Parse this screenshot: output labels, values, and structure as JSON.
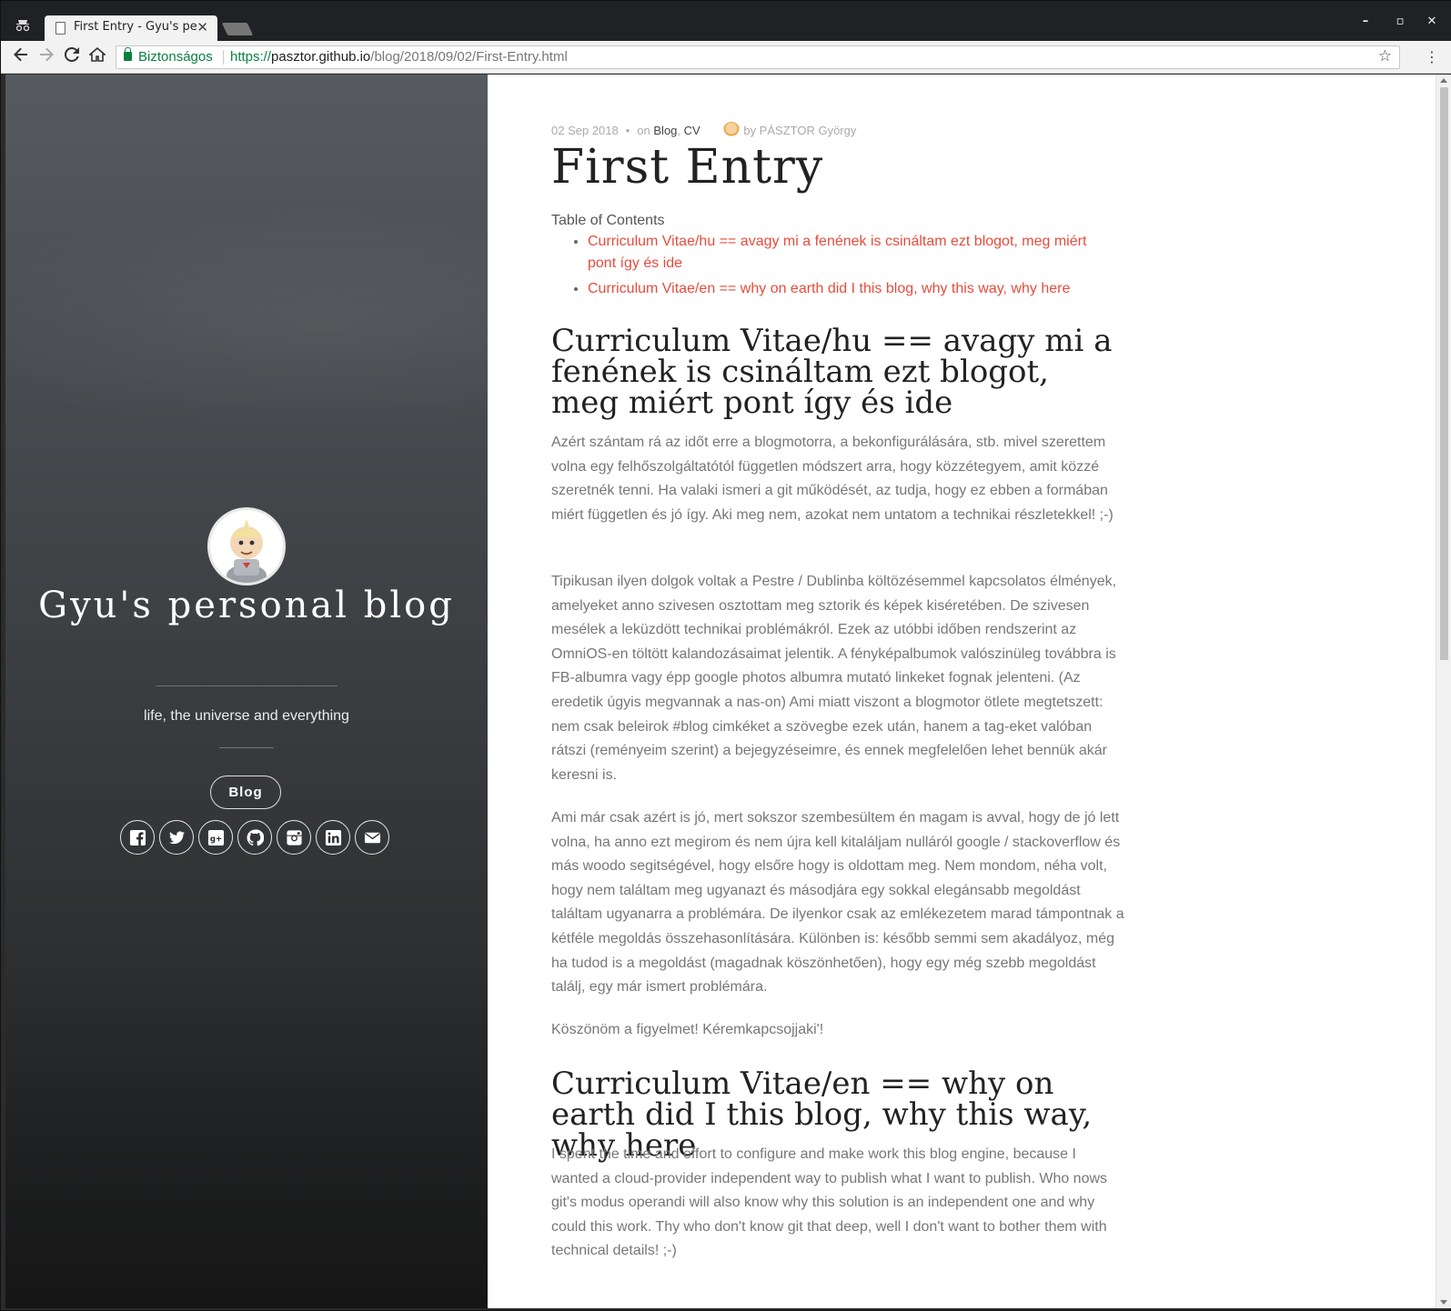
{
  "browser": {
    "tab_title": "First Entry - Gyu's personal blog",
    "security_label": "Biztonságos",
    "url_scheme": "https://",
    "url_host": "pasztor.github.io",
    "url_path": "/blog/2018/09/02/First-Entry.html"
  },
  "sidebar": {
    "title": "Gyu's personal blog",
    "tagline": "life, the universe and everything",
    "nav_button": "Blog",
    "social": [
      "facebook-icon",
      "twitter-icon",
      "google-plus-icon",
      "github-icon",
      "instagram-icon",
      "linkedin-icon",
      "email-icon"
    ]
  },
  "post": {
    "date": "02 Sep 2018",
    "on_label": "on",
    "categories": [
      "Blog",
      "CV"
    ],
    "author": "by PÁSZTOR György",
    "title": "First Entry",
    "toc_title": "Table of Contents",
    "toc": [
      "Curriculum Vitae/hu == avagy mi a fenének is csináltam ezt blogot, meg miért pont így és ide",
      "Curriculum Vitae/en == why on earth did I this blog, why this way, why here"
    ],
    "h2_hu": "Curriculum Vitae/hu == avagy mi a fenének is csináltam ezt blogot, meg miért pont így és ide",
    "p1": "Azért szántam rá az időt erre a blogmotorra, a bekonfigurálására, stb. mivel szerettem volna egy felhőszolgáltatótól független módszert arra, hogy közzétegyem, amit közzé szeretnék tenni. Ha valaki ismeri a git működését, az tudja, hogy ez ebben a formában miért független és jó így. Aki meg nem, azokat nem untatom a technikai részletekkel! ;-)",
    "p2": "Tipikusan ilyen dolgok voltak a Pestre / Dublinba költözésemmel kapcsolatos élmények, amelyeket anno szivesen osztottam meg sztorik és képek kiséretében. De szivesen mesélek a leküzdött technikai problémákról. Ezek az utóbbi időben rendszerint az OmniOS-en töltött kalandozásaimat jelentik. A fényképalbumok valószinüleg továbbra is FB-albumra vagy épp google photos albumra mutató linkeket fognak jelenteni. (Az eredetik úgyis megvannak a nas-on) Ami miatt viszont a blogmotor ötlete megtetszett: nem csak beleirok #blog cimkéket a szövegbe ezek után, hanem a tag-eket valóban rátszi (reményeim szerint) a bejegyzéseimre, és ennek megfelelően lehet bennük akár keresni is.",
    "p3": "Ami már csak azért is jó, mert sokszor szembesültem én magam is avval, hogy de jó lett volna, ha anno ezt megirom és nem újra kell kitaláljam nulláról google / stackoverflow és más woodo segitségével, hogy elsőre hogy is oldottam meg. Nem mondom, néha volt, hogy nem találtam meg ugyanazt és másodjára egy sokkal elegánsabb megoldást találtam ugyanarra a problémára. De ilyenkor csak az emlékezetem marad támpontnak a kétféle megoldás összehasonlítására. Különben is: később semmi sem akadályoz, még ha tudod is a megoldást (magadnak köszönhetően), hogy egy még szebb megoldást találj, egy már ismert problémára.",
    "p4": "Köszönöm a figyelmet! Kéremkapcsojjaki'!",
    "h2_en": "Curriculum Vitae/en == why on earth did I this blog, why this way, why here",
    "p5": "I spent the time and effort to configure and make work this blog engine, because I wanted a cloud-provider independent way to publish what I want to publish. Who nows git's modus operandi will also know why this solution is an independent one and why could this work. Thy who don't know git that deep, well I don't want to bother them with technical details! ;-)"
  }
}
